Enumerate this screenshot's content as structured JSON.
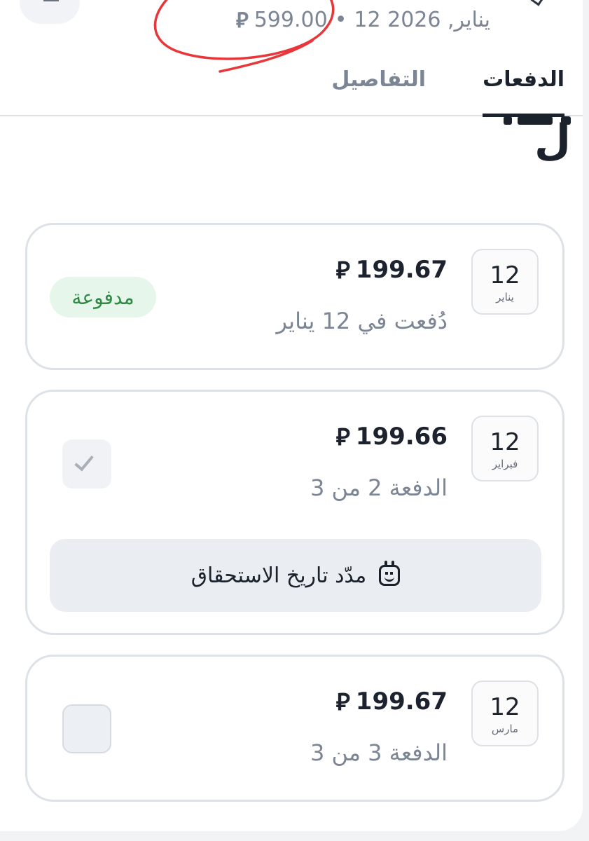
{
  "header": {
    "summary_date": "12 يناير, 2026",
    "separator": "•",
    "summary_amount": "599.00",
    "currency_symbol": "⃁"
  },
  "tabs": [
    {
      "label": "الدفعات",
      "active": true
    },
    {
      "label": "التفاصيل",
      "active": false
    }
  ],
  "partial_heading": "ل",
  "payments": [
    {
      "day": "12",
      "month": "يناير",
      "amount": "199.67",
      "subtitle": "دُفعت في 12 يناير",
      "status": "مدفوعة"
    },
    {
      "day": "12",
      "month": "فبراير",
      "amount": "199.66",
      "subtitle": "الدفعة 2 من 3",
      "action_label": "مدّد تاريخ الاستحقاق"
    },
    {
      "day": "12",
      "month": "مارس",
      "amount": "199.67",
      "subtitle": "الدفعة 3 من 3"
    }
  ],
  "colors": {
    "paid_badge_bg": "#e6f6ea",
    "paid_badge_text": "#2f8a45",
    "annotation_red": "#e8363a"
  }
}
